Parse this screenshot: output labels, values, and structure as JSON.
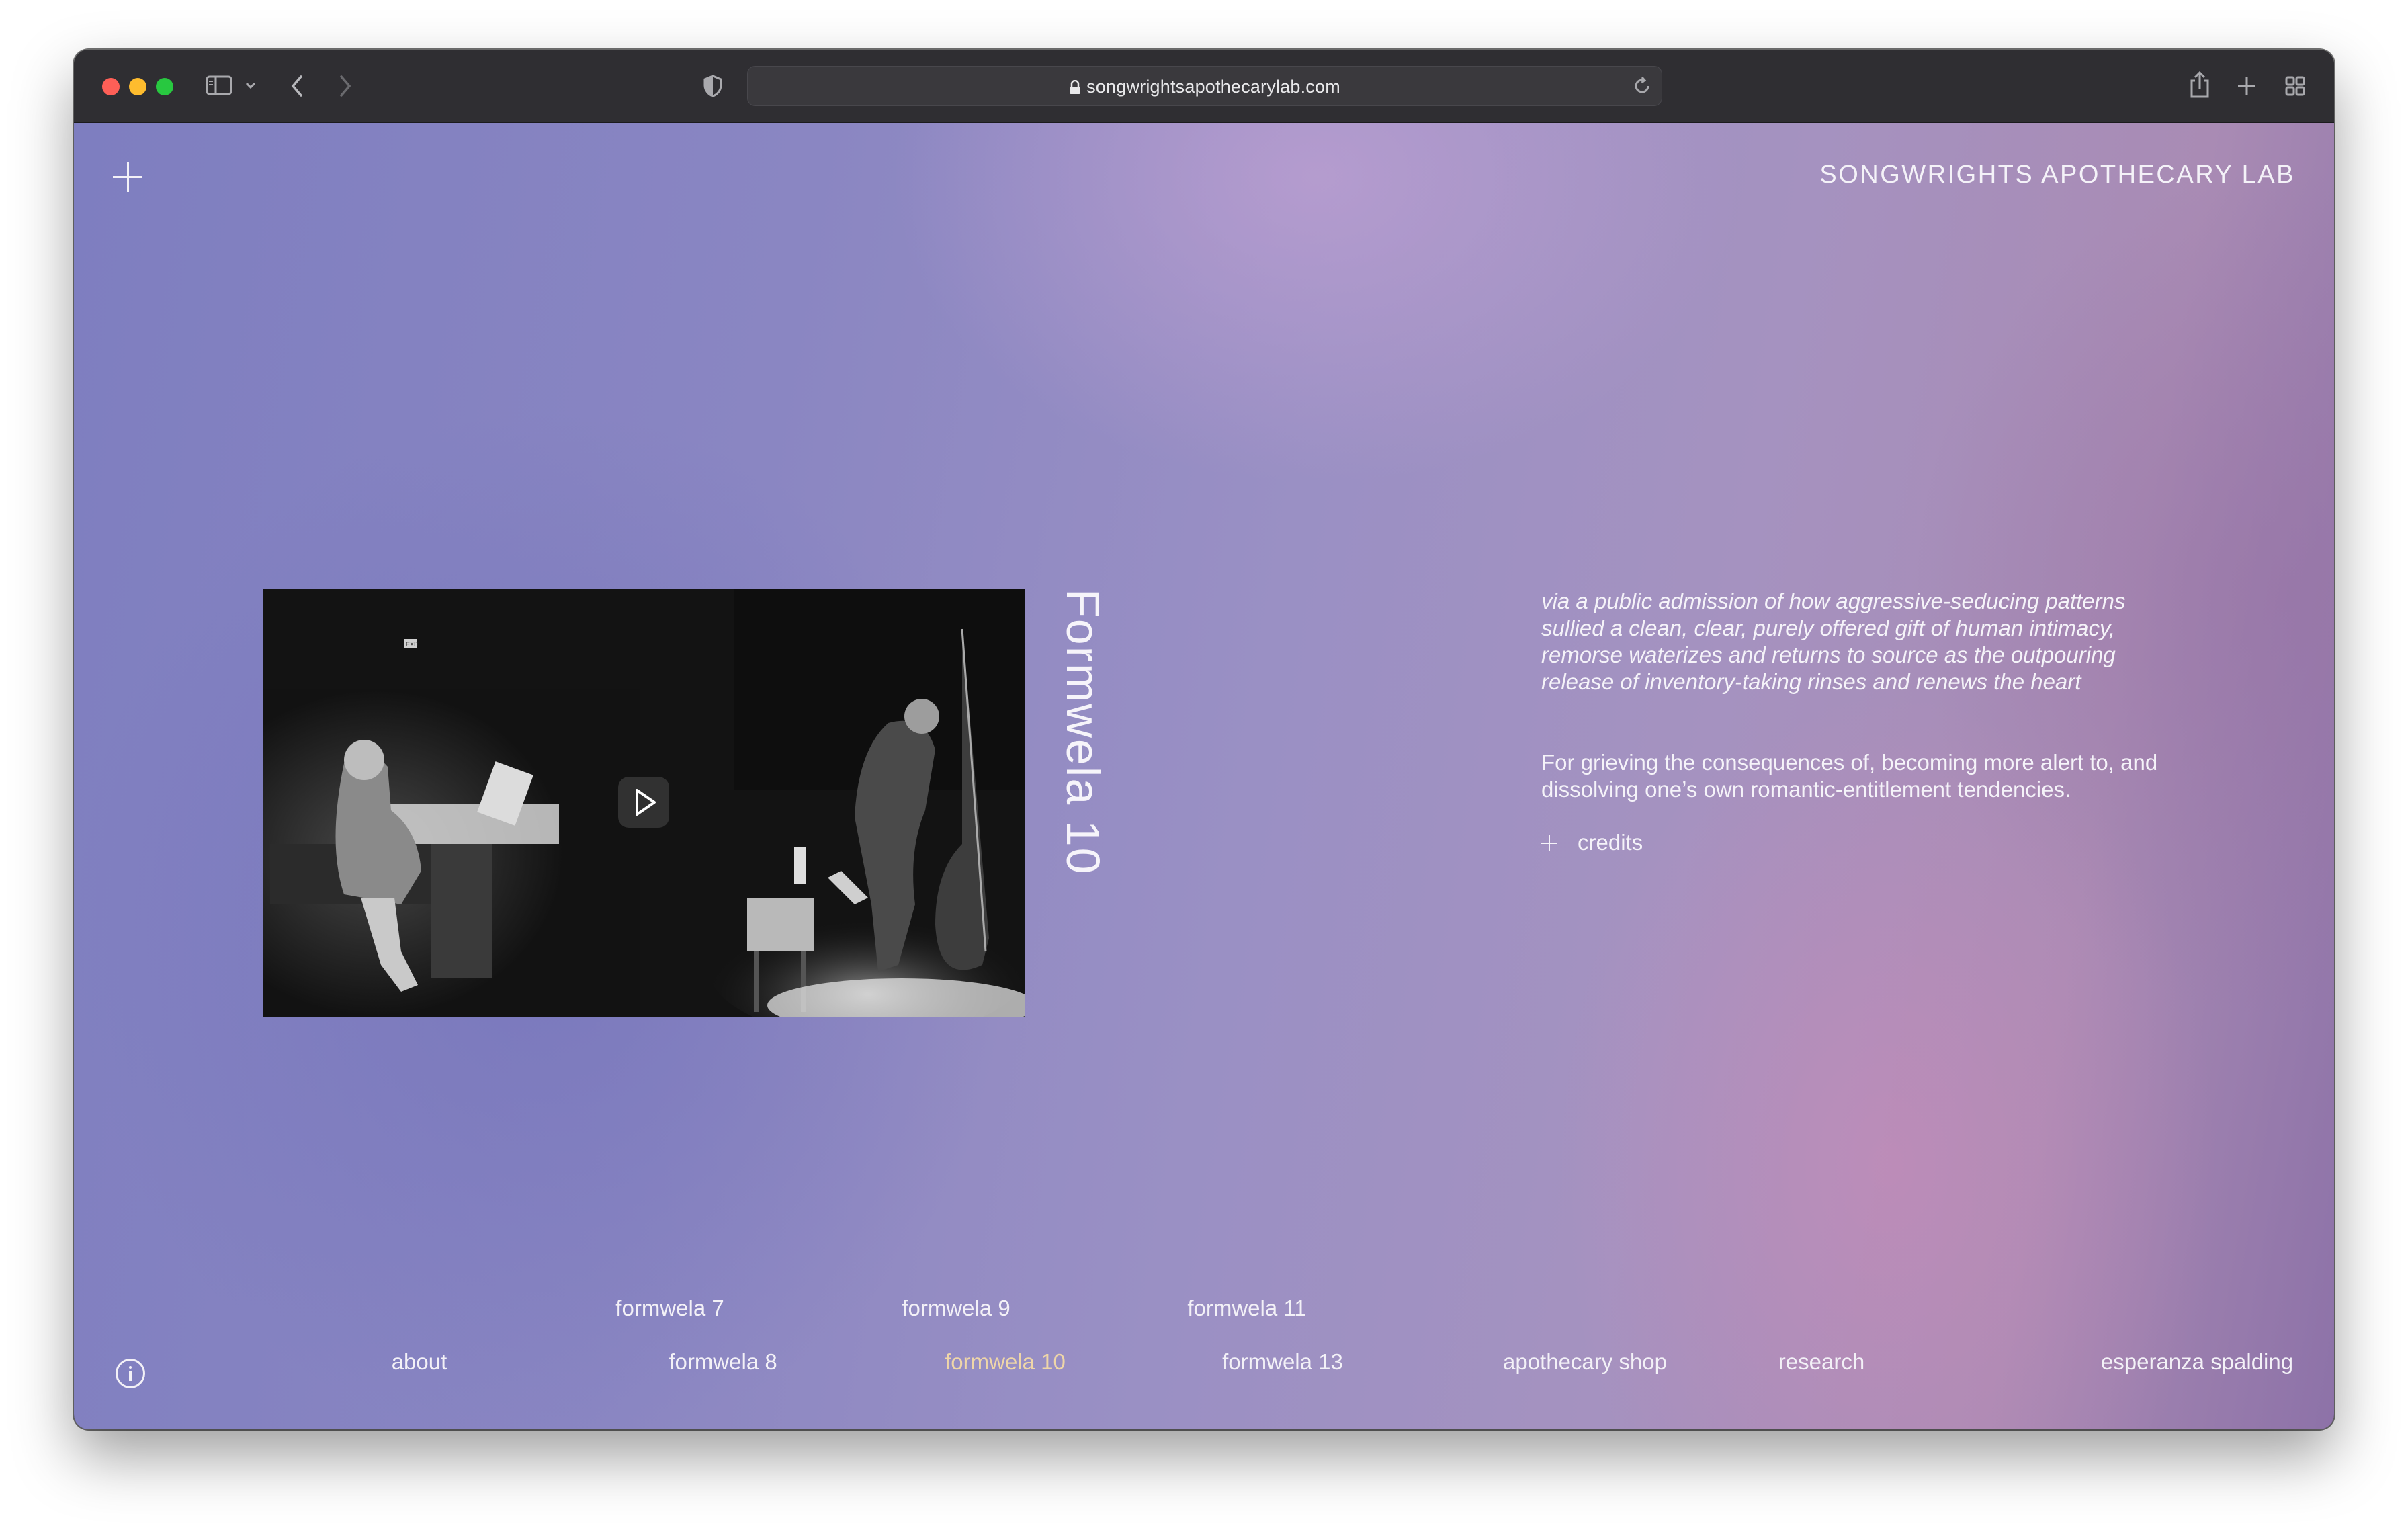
{
  "browser": {
    "url": "songwrightsapothecarylab.com",
    "traffic_light_colors": [
      "#fe5f57",
      "#febc2e",
      "#28c840"
    ]
  },
  "site": {
    "title": "SONGWRIGHTS APOTHECARY LAB"
  },
  "main": {
    "piece_title": "Formwela 10",
    "description_italic": "via a public admission of how aggressive-seducing patterns sullied a clean, clear, purely offered gift of human intimacy, remorse waterizes and returns to source as the outpouring release of inventory-taking rinses and renews the heart",
    "description_normal": "For grieving the consequences of, becoming more alert to, and dissolving one’s own romantic-entitlement tendencies.",
    "credits_label": "credits",
    "video_exit_sign": "EXIT"
  },
  "nav": {
    "top_row": [
      "formwela 7",
      "formwela 9",
      "formwela 11"
    ],
    "bottom_row": [
      "about",
      "formwela 8",
      "formwela 10",
      "formwela 13",
      "apothecary shop",
      "research",
      "esperanza spalding"
    ],
    "active": "formwela 10",
    "active_color": "#efd6a8"
  },
  "icons": {
    "menu": "plus-icon",
    "info": "info-icon",
    "play": "play-icon",
    "credits": "plus-icon"
  }
}
